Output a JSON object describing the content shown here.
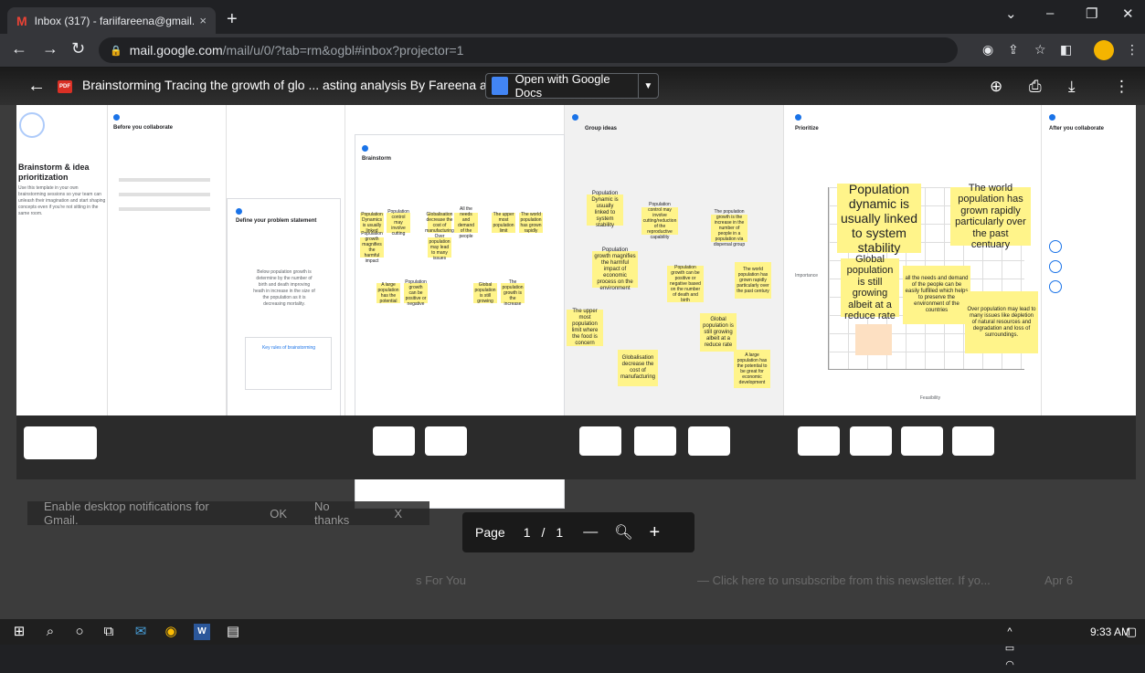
{
  "browser": {
    "tab_title": "Inbox (317) - fariifareena@gmail.",
    "tab_close": "×",
    "new_tab": "+",
    "url_host": "mail.google.com",
    "url_path": "/mail/u/0/?tab=rm&ogbl#inbox?projector=1"
  },
  "viewer": {
    "title": "Brainstorming Tracing the growth of glo ... asting analysis By Fareena and te",
    "open_with": "Open with Google Docs",
    "pdf_badge": "PDF"
  },
  "doc": {
    "col1": {
      "title": "Brainstorm & idea prioritization",
      "body": "Use this template in your own brainstorming sessions so your team can unleash their imagination and start shaping concepts even if you're not sitting in the same room."
    },
    "col2": {
      "title": "Before you collaborate"
    },
    "col3": {
      "title": "Define your problem statement",
      "statement": "Below population growth is determine by the number of birth and death improving heath in increase in the size of the population as it is decreasing mortality.",
      "tips_title": "Key rules of brainstorming"
    },
    "col4": {
      "title": "Brainstorm",
      "stickies": [
        "Population Dynamics is usually linked",
        "Population growth magnifies the harmful impact",
        "Population control may involve cutting",
        "Globalisation decrease the cost of manufacturing",
        "All the needs and demand of the people",
        "Over population may lead to many issues",
        "The upper most population limit",
        "The world population has grown rapidly",
        "A large population has the potential",
        "Population growth can be positive or negative",
        "Global population is still growing",
        "The population growth is the increase"
      ]
    },
    "col5": {
      "title": "Group ideas",
      "stickies": [
        "Population Dynamic is usually linked to system stability",
        "Population control may involve cutting/reduction of the reproductive capability",
        "The population growth is the increase in the number of people in a population via dispersal group",
        "Population growth magnifies the harmful impact of economic process on the environment",
        "Population growth can be positive or negative based on the number of death and birth",
        "The world population has grown rapidly particularly over the past century",
        "The upper most population limit where the food is concern",
        "Global population is still growing albeit at a reduce rate",
        "Globalisation decrease the cost of manufacturing",
        "A large population has the potential to be great for economic development"
      ]
    },
    "col6": {
      "title": "Prioritize",
      "axis_y": "Importance",
      "axis_x": "Feasibility",
      "stickies": [
        "Population dynamic is usually linked to system stability",
        "The world population has grown rapidly particularly over the past centuary",
        "Global population is still growing albeit at a reduce rate",
        "all the needs and demand of the people can be easily fulfilled which helps to preserve the environment of the countries",
        "Over population may lead to many issues like depletion of natural resources and degradation and loss of surroundings."
      ]
    },
    "col7": {
      "title": "After you collaborate"
    }
  },
  "pager": {
    "label": "Page",
    "current": "1",
    "sep": "/",
    "total": "1",
    "minus": "—",
    "plus": "+"
  },
  "notification": {
    "text": "Enable desktop notifications for Gmail.",
    "ok": "OK",
    "no": "No thanks",
    "x": "X"
  },
  "background": {
    "frag1": "s For You",
    "frag2": "— Click here to unsubscribe from this newsletter. If yo...",
    "date": "Apr 6"
  },
  "taskbar": {
    "time": "9:33 AM"
  }
}
